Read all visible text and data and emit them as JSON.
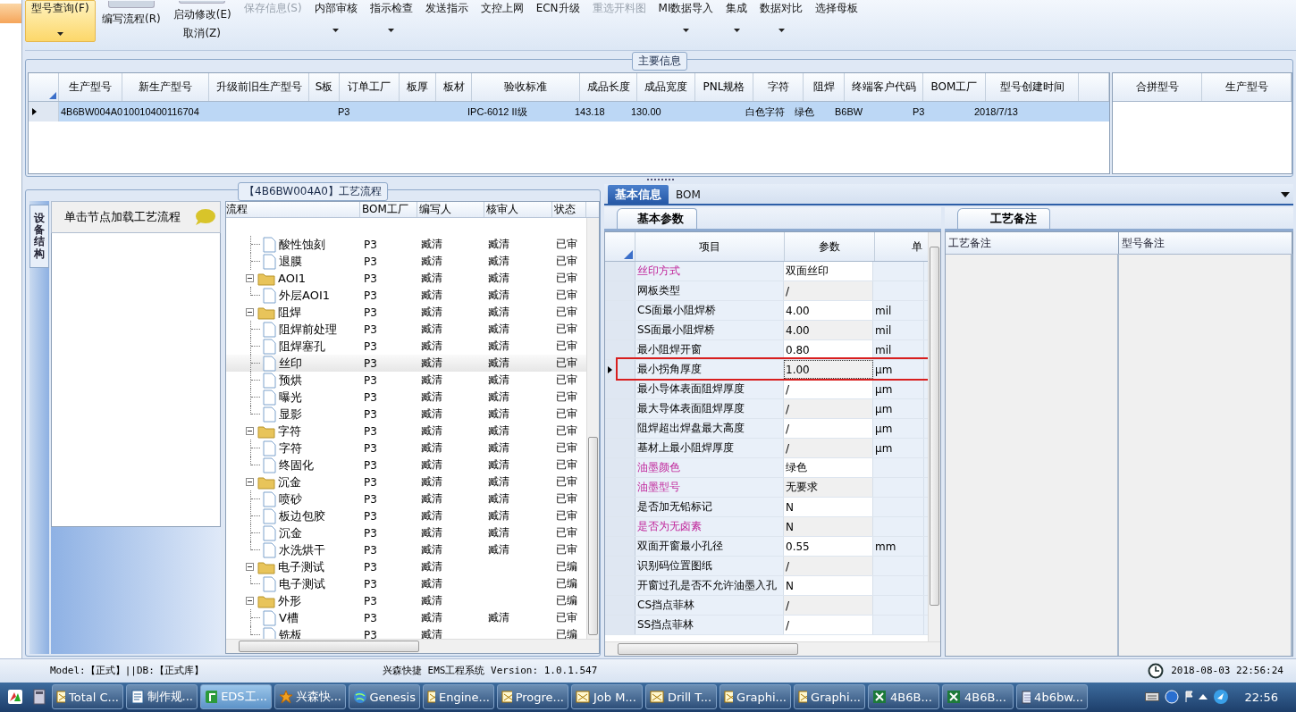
{
  "toolbar": [
    {
      "label": "型号查询(F)",
      "kind": "small",
      "dropdown": true,
      "disabled": false,
      "selected": true
    },
    {
      "label": "编写流程(R)",
      "kind": "large",
      "dropdown": false,
      "disabled": false,
      "selected": false
    },
    {
      "label": "启动修改(E)",
      "sublabel": "取消(Z)",
      "kind": "large",
      "dropdown": false,
      "disabled": false,
      "selected": false
    },
    {
      "label": "保存信息(S)",
      "kind": "small",
      "dropdown": false,
      "disabled": true,
      "selected": false
    },
    {
      "label": "内部审核",
      "kind": "small",
      "dropdown": true,
      "disabled": false,
      "selected": false
    },
    {
      "label": "指示检查",
      "kind": "small",
      "dropdown": true,
      "disabled": false,
      "selected": false
    },
    {
      "label": "发送指示",
      "kind": "small",
      "dropdown": false,
      "disabled": false,
      "selected": false
    },
    {
      "label": "文控上网",
      "kind": "small",
      "dropdown": false,
      "disabled": false,
      "selected": false
    },
    {
      "label": "ECN升级",
      "kind": "small",
      "dropdown": false,
      "disabled": false,
      "selected": false
    },
    {
      "label": "重选开料图",
      "kind": "small",
      "dropdown": false,
      "disabled": true,
      "selected": false
    },
    {
      "label": "MI数据导入",
      "kind": "small",
      "dropdown": true,
      "disabled": false,
      "selected": false
    },
    {
      "label": "集成",
      "kind": "small",
      "dropdown": true,
      "disabled": false,
      "selected": false
    },
    {
      "label": "数据对比",
      "kind": "small",
      "dropdown": true,
      "disabled": false,
      "selected": false
    },
    {
      "label": "选择母板",
      "kind": "small",
      "dropdown": false,
      "disabled": false,
      "selected": false
    }
  ],
  "main_info": {
    "title": "主要信息",
    "columns": [
      "生产型号",
      "新生产型号",
      "升级前旧生产型号",
      "S板",
      "订单工厂",
      "板厚",
      "板材",
      "验收标准",
      "成品长度",
      "成品宽度",
      "PNL规格",
      "字符",
      "阻焊",
      "终端客户代码",
      "BOM工厂",
      "型号创建时间"
    ],
    "rows": [
      {
        "selected": true,
        "cells": [
          "4B6BW004A0",
          "10010400116704",
          null,
          null,
          "P3",
          null,
          null,
          "IPC-6012 II级",
          "143.18",
          "130.00",
          null,
          "白色字符",
          "绿色",
          "B6BW",
          "P3",
          "2018/7/13"
        ]
      }
    ],
    "merge_columns": [
      "合拼型号",
      "生产型号"
    ]
  },
  "equipment_tab": "设备结构",
  "node_hint": "单击节点加载工艺流程",
  "process": {
    "title": "【4B6BW004A0】工艺流程",
    "columns": [
      "流程",
      "BOM工厂",
      "编写人",
      "核审人",
      "状态"
    ],
    "rows": [
      {
        "label": "酸性蚀刻",
        "kind": "step",
        "bom": "P3",
        "writer": "臧清",
        "reviewer": "臧清",
        "status": "已审",
        "selected": false
      },
      {
        "label": "退膜",
        "kind": "step",
        "bom": "P3",
        "writer": "臧清",
        "reviewer": "臧清",
        "status": "已审",
        "selected": false
      },
      {
        "label": "AOI1",
        "kind": "folder",
        "expanded": true,
        "bom": "P3",
        "writer": "臧清",
        "reviewer": "臧清",
        "status": "已审",
        "selected": false,
        "children": [
          {
            "label": "外层AOI1",
            "kind": "step",
            "bom": "P3",
            "writer": "臧清",
            "reviewer": "臧清",
            "status": "已审",
            "selected": false
          }
        ]
      },
      {
        "label": "阻焊",
        "kind": "folder",
        "expanded": true,
        "bom": "P3",
        "writer": "臧清",
        "reviewer": "臧清",
        "status": "已审",
        "selected": false,
        "children": [
          {
            "label": "阻焊前处理",
            "kind": "step",
            "bom": "P3",
            "writer": "臧清",
            "reviewer": "臧清",
            "status": "已审",
            "selected": false
          },
          {
            "label": "阻焊塞孔",
            "kind": "step",
            "bom": "P3",
            "writer": "臧清",
            "reviewer": "臧清",
            "status": "已审",
            "selected": false
          },
          {
            "label": "丝印",
            "kind": "step",
            "bom": "P3",
            "writer": "臧清",
            "reviewer": "臧清",
            "status": "已审",
            "selected": true
          },
          {
            "label": "预烘",
            "kind": "step",
            "bom": "P3",
            "writer": "臧清",
            "reviewer": "臧清",
            "status": "已审",
            "selected": false
          },
          {
            "label": "曝光",
            "kind": "step",
            "bom": "P3",
            "writer": "臧清",
            "reviewer": "臧清",
            "status": "已审",
            "selected": false
          },
          {
            "label": "显影",
            "kind": "step",
            "bom": "P3",
            "writer": "臧清",
            "reviewer": "臧清",
            "status": "已审",
            "selected": false
          }
        ]
      },
      {
        "label": "字符",
        "kind": "folder",
        "expanded": true,
        "bom": "P3",
        "writer": "臧清",
        "reviewer": "臧清",
        "status": "已审",
        "selected": false,
        "children": [
          {
            "label": "字符",
            "kind": "step",
            "bom": "P3",
            "writer": "臧清",
            "reviewer": "臧清",
            "status": "已审",
            "selected": false
          },
          {
            "label": "终固化",
            "kind": "step",
            "bom": "P3",
            "writer": "臧清",
            "reviewer": "臧清",
            "status": "已审",
            "selected": false
          }
        ]
      },
      {
        "label": "沉金",
        "kind": "folder",
        "expanded": true,
        "bom": "P3",
        "writer": "臧清",
        "reviewer": "臧清",
        "status": "已审",
        "selected": false,
        "children": [
          {
            "label": "喷砂",
            "kind": "step",
            "bom": "P3",
            "writer": "臧清",
            "reviewer": "臧清",
            "status": "已审",
            "selected": false
          },
          {
            "label": "板边包胶",
            "kind": "step",
            "bom": "P3",
            "writer": "臧清",
            "reviewer": "臧清",
            "status": "已审",
            "selected": false
          },
          {
            "label": "沉金",
            "kind": "step",
            "bom": "P3",
            "writer": "臧清",
            "reviewer": "臧清",
            "status": "已审",
            "selected": false
          },
          {
            "label": "水洗烘干",
            "kind": "step",
            "bom": "P3",
            "writer": "臧清",
            "reviewer": "臧清",
            "status": "已审",
            "selected": false
          }
        ]
      },
      {
        "label": "电子测试",
        "kind": "folder",
        "expanded": true,
        "bom": "P3",
        "writer": "臧清",
        "status": "已编",
        "selected": false,
        "children": [
          {
            "label": "电子测试",
            "kind": "step",
            "bom": "P3",
            "writer": "臧清",
            "status": "已编",
            "selected": false
          }
        ]
      },
      {
        "label": "外形",
        "kind": "folder",
        "expanded": true,
        "bom": "P3",
        "writer": "臧清",
        "status": "已编",
        "selected": false,
        "children": [
          {
            "label": "V槽",
            "kind": "step",
            "bom": "P3",
            "writer": "臧清",
            "reviewer": "臧清",
            "status": "已审",
            "selected": false
          },
          {
            "label": "铣板",
            "kind": "step",
            "bom": "P3",
            "writer": "臧清",
            "status": "已编",
            "selected": false
          }
        ]
      }
    ]
  },
  "detail_tabs": [
    {
      "label": "基本信息",
      "selected": true
    },
    {
      "label": "BOM",
      "selected": false
    }
  ],
  "basic_params": {
    "tab": "基本参数",
    "columns": [
      "项目",
      "参数",
      "单"
    ],
    "rows": [
      {
        "item": "丝印方式",
        "value": "双面丝印",
        "emphasized": true,
        "selected": false,
        "outlined": false
      },
      {
        "item": "网板类型",
        "value": "/",
        "emphasized": false,
        "selected": false,
        "outlined": false
      },
      {
        "item": "CS面最小阻焊桥",
        "value": "4.00",
        "unit": "mil",
        "emphasized": false,
        "selected": false,
        "outlined": false
      },
      {
        "item": "SS面最小阻焊桥",
        "value": "4.00",
        "unit": "mil",
        "emphasized": false,
        "selected": false,
        "outlined": false
      },
      {
        "item": "最小阻焊开窗",
        "value": "0.80",
        "unit": "mil",
        "emphasized": false,
        "selected": false,
        "outlined": false
      },
      {
        "item": "最小拐角厚度",
        "value": "1.00",
        "unit": "μm",
        "emphasized": false,
        "selected": true,
        "outlined": true
      },
      {
        "item": "最小导体表面阻焊厚度",
        "value": "/",
        "unit": "μm",
        "emphasized": false,
        "selected": false,
        "outlined": false
      },
      {
        "item": "最大导体表面阻焊厚度",
        "value": "/",
        "unit": "μm",
        "emphasized": false,
        "selected": false,
        "outlined": false
      },
      {
        "item": "阻焊超出焊盘最大高度",
        "value": "/",
        "unit": "μm",
        "emphasized": false,
        "selected": false,
        "outlined": false
      },
      {
        "item": "基材上最小阻焊厚度",
        "value": "/",
        "unit": "μm",
        "emphasized": false,
        "selected": false,
        "outlined": false
      },
      {
        "item": "油墨颜色",
        "value": "绿色",
        "emphasized": true,
        "selected": false,
        "outlined": false
      },
      {
        "item": "油墨型号",
        "value": "无要求",
        "emphasized": true,
        "selected": false,
        "outlined": false
      },
      {
        "item": "是否加无铅标记",
        "value": "N",
        "emphasized": false,
        "selected": false,
        "outlined": false
      },
      {
        "item": "是否为无卤素",
        "value": "N",
        "emphasized": true,
        "selected": false,
        "outlined": false
      },
      {
        "item": "双面开窗最小孔径",
        "value": "0.55",
        "unit": "mm",
        "emphasized": false,
        "selected": false,
        "outlined": false
      },
      {
        "item": "识别码位置图纸",
        "value": "/",
        "emphasized": false,
        "selected": false,
        "outlined": false
      },
      {
        "item": "开窗过孔是否不允许油墨入孔",
        "value": "N",
        "emphasized": false,
        "selected": false,
        "outlined": false
      },
      {
        "item": "CS挡点菲林",
        "value": "/",
        "emphasized": false,
        "selected": false,
        "outlined": false
      },
      {
        "item": "SS挡点菲林",
        "value": "/",
        "emphasized": false,
        "selected": false,
        "outlined": false
      }
    ]
  },
  "remarks": {
    "tab": "工艺备注",
    "columns": [
      "工艺备注",
      "型号备注"
    ]
  },
  "status_bar": {
    "model": "Model:【正式】||DB:【正式库】",
    "app": "兴森快捷 EMS工程系统 Version: 1.0.1.547",
    "datetime": "2018-08-03 22:56:24"
  },
  "taskbar": {
    "tasks": [
      {
        "label": "Total C...",
        "kind": "window",
        "selected": false
      },
      {
        "label": "制作规...",
        "kind": "document",
        "selected": false
      },
      {
        "label": "EDS工...",
        "kind": "app",
        "selected": true
      },
      {
        "label": "兴森快...",
        "kind": "star",
        "selected": false
      },
      {
        "label": "Genesis",
        "kind": "globe",
        "selected": false
      },
      {
        "label": "Engine...",
        "kind": "window",
        "selected": false
      },
      {
        "label": "Progre...",
        "kind": "window",
        "selected": false
      },
      {
        "label": "Job M...",
        "kind": "window",
        "selected": false
      },
      {
        "label": "Drill T...",
        "kind": "window",
        "selected": false
      },
      {
        "label": "Graphi...",
        "kind": "window",
        "selected": false
      },
      {
        "label": "Graphi...",
        "kind": "window",
        "selected": false
      },
      {
        "label": "4B6B...",
        "kind": "spreadsheet",
        "selected": false
      },
      {
        "label": "4B6B...",
        "kind": "spreadsheet",
        "selected": false
      },
      {
        "label": "4b6bw...",
        "kind": "notepad",
        "selected": false
      }
    ],
    "clock": "22:56"
  }
}
